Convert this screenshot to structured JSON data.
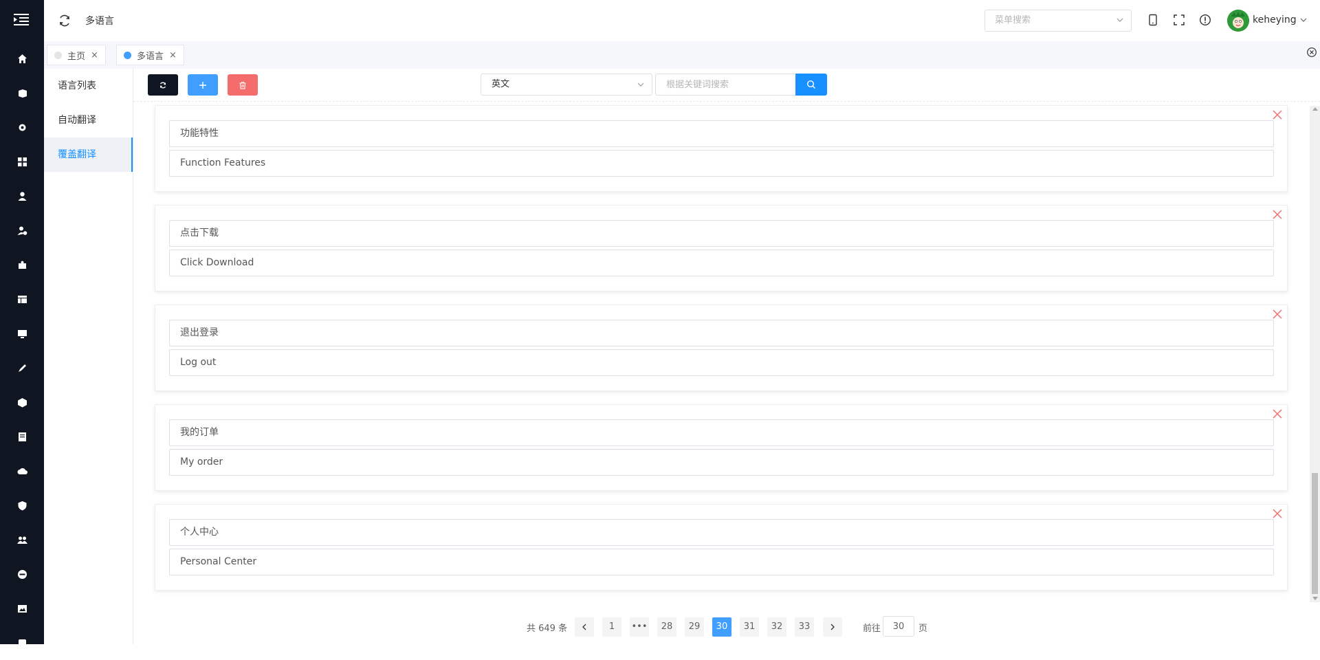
{
  "header": {
    "title": "多语言",
    "menu_search_placeholder": "菜单搜索",
    "username": "keheying"
  },
  "tabs": [
    {
      "label": "主页",
      "active": false
    },
    {
      "label": "多语言",
      "active": true
    }
  ],
  "tab_close_glyph": "×",
  "submenu": {
    "items": [
      {
        "label": "语言列表",
        "active": false
      },
      {
        "label": "自动翻译",
        "active": false
      },
      {
        "label": "覆盖翻译",
        "active": true
      }
    ]
  },
  "toolbar": {
    "language_selected": "英文",
    "keyword_placeholder": "根据关键词搜索",
    "colors": {
      "refresh": "#0f1521",
      "add": "#409eff",
      "delete": "#f56c6c",
      "search": "#1890ff"
    }
  },
  "entries": [
    {
      "source": "功能特性",
      "translation": "Function Features"
    },
    {
      "source": "点击下载",
      "translation": "Click Download"
    },
    {
      "source": "退出登录",
      "translation": "Log out"
    },
    {
      "source": "我的订单",
      "translation": "My order"
    },
    {
      "source": "个人中心",
      "translation": "Personal Center"
    }
  ],
  "pagination": {
    "total_text": "共 649 条",
    "pages": [
      "1",
      "•••",
      "28",
      "29",
      "30",
      "31",
      "32",
      "33"
    ],
    "current": "30",
    "goto_label": "前往",
    "goto_value": "30",
    "goto_suffix": "页"
  },
  "icons": {
    "rail": [
      "home-icon",
      "box-icon",
      "gear-icon",
      "grid-icon",
      "user-icon",
      "user-settings-icon",
      "puzzle-icon",
      "layout-icon",
      "monitor-icon",
      "pen-icon",
      "cube-icon",
      "document-icon",
      "cloud-upload-icon",
      "shield-icon",
      "group-icon",
      "minus-circle-icon",
      "image-icon",
      "tag-icon"
    ]
  }
}
